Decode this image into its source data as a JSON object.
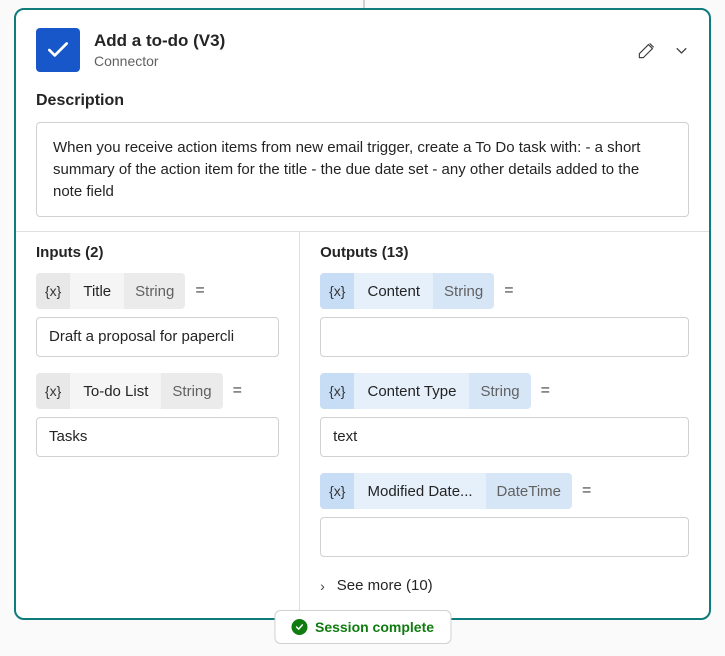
{
  "header": {
    "title": "Add a to-do (V3)",
    "subtitle": "Connector"
  },
  "description": {
    "label": "Description",
    "text": "When you receive action items from new email trigger, create a To Do task with: - a short summary of the action item for the title - the due date set - any other details added to the note field"
  },
  "inputs": {
    "title": "Inputs (2)",
    "items": [
      {
        "name": "Title",
        "type": "String",
        "value": "Draft a proposal for papercli"
      },
      {
        "name": "To-do List",
        "type": "String",
        "value": "Tasks"
      }
    ]
  },
  "outputs": {
    "title": "Outputs (13)",
    "items": [
      {
        "name": "Content",
        "type": "String",
        "value": ""
      },
      {
        "name": "Content Type",
        "type": "String",
        "value": "text"
      },
      {
        "name": "Modified Date...",
        "type": "DateTime",
        "value": ""
      }
    ],
    "see_more": "See more (10)"
  },
  "session": {
    "label": "Session complete"
  },
  "glyphs": {
    "var": "{x}",
    "equals": "=",
    "chevron_right": "›"
  }
}
